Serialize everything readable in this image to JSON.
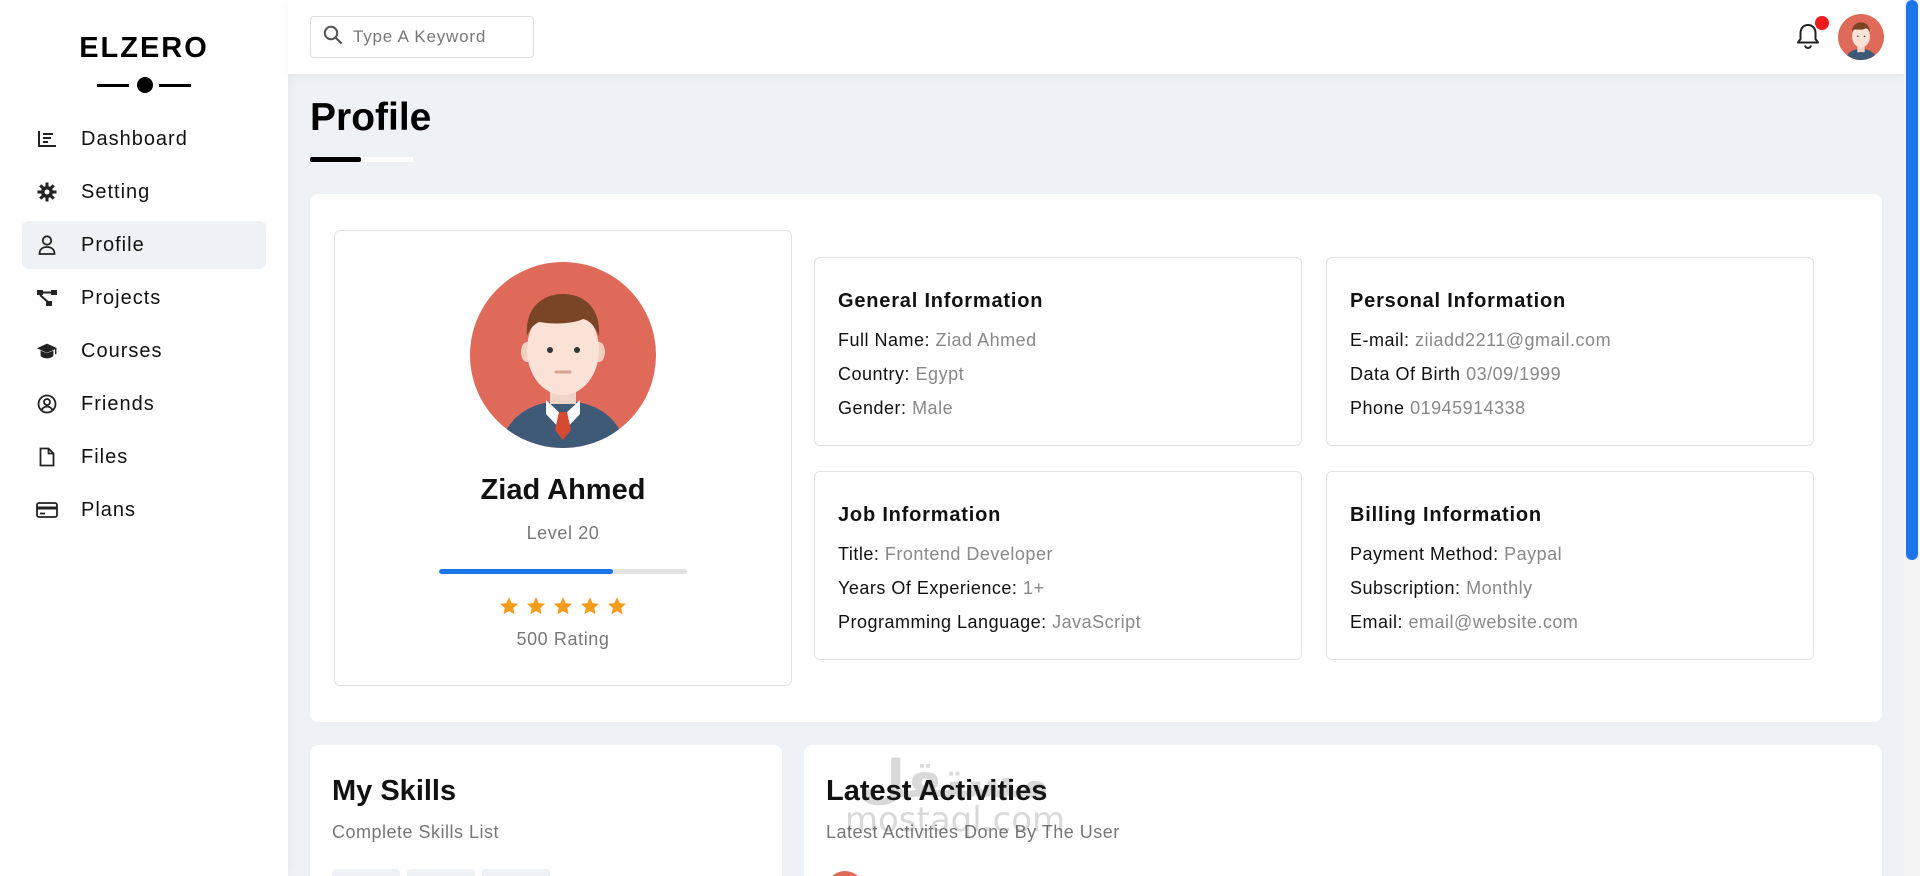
{
  "brand": {
    "name": "ELZERO"
  },
  "sidebar": {
    "items": [
      {
        "label": "Dashboard",
        "icon": "chart-icon"
      },
      {
        "label": "Setting",
        "icon": "gear-icon"
      },
      {
        "label": "Profile",
        "icon": "user-icon",
        "active": true
      },
      {
        "label": "Projects",
        "icon": "diagram-icon"
      },
      {
        "label": "Courses",
        "icon": "graduation-cap-icon"
      },
      {
        "label": "Friends",
        "icon": "user-circle-icon"
      },
      {
        "label": "Files",
        "icon": "file-icon"
      },
      {
        "label": "Plans",
        "icon": "credit-card-icon"
      }
    ]
  },
  "topbar": {
    "search_placeholder": "Type A Keyword",
    "has_notification": true
  },
  "page": {
    "title": "Profile"
  },
  "profile": {
    "name": "Ziad Ahmed",
    "level": "Level 20",
    "progress": 0.7,
    "stars": 5,
    "rating": "500 Rating"
  },
  "general_info": {
    "heading": "General Information",
    "rows": [
      {
        "label": "Full Name:",
        "value": "Ziad Ahmed"
      },
      {
        "label": "Country:",
        "value": "Egypt"
      },
      {
        "label": "Gender:",
        "value": "Male"
      }
    ]
  },
  "personal_info": {
    "heading": "Personal Information",
    "rows": [
      {
        "label": "E-mail:",
        "value": "ziiadd2211@gmail.com"
      },
      {
        "label": "Data Of Birth",
        "value": "03/09/1999"
      },
      {
        "label": "Phone",
        "value": "01945914338"
      }
    ]
  },
  "job_info": {
    "heading": "Job Information",
    "rows": [
      {
        "label": "Title:",
        "value": "Frontend Developer"
      },
      {
        "label": "Years Of Experience:",
        "value": "1+"
      },
      {
        "label": "Programming Language:",
        "value": "JavaScript"
      }
    ]
  },
  "billing_info": {
    "heading": "Billing Information",
    "rows": [
      {
        "label": "Payment Method:",
        "value": "Paypal"
      },
      {
        "label": "Subscription:",
        "value": "Monthly"
      },
      {
        "label": "Email:",
        "value": "email@website.com"
      }
    ]
  },
  "skills": {
    "title": "My Skills",
    "subtitle": "Complete Skills List"
  },
  "activities": {
    "title": "Latest Activities",
    "subtitle": "Latest Activities Done By The User"
  },
  "watermark": {
    "arabic": "مستقل",
    "latin": "mostaql.com"
  },
  "colors": {
    "accent": "#1a75e8",
    "star": "#f59c1a",
    "badge": "#f01a1a",
    "avatar_bg": "#e06a5a"
  }
}
